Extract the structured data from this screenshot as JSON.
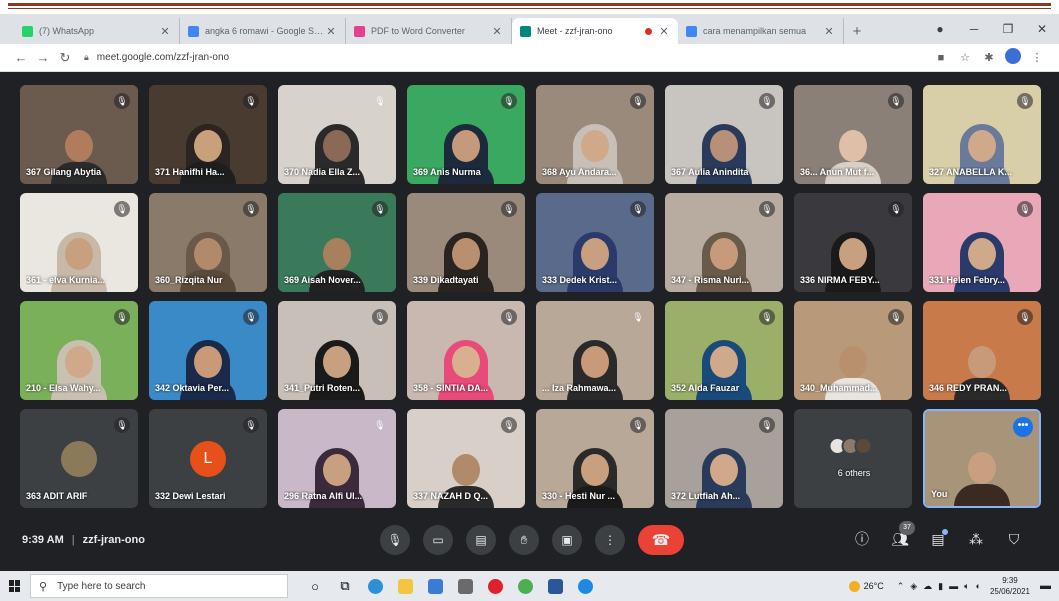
{
  "browser": {
    "tabs": [
      {
        "title": "(7) WhatsApp",
        "favicon_color": "#25d366",
        "active": false
      },
      {
        "title": "angka 6 romawi - Google Search",
        "favicon_color": "#4285f4",
        "active": false
      },
      {
        "title": "PDF to Word Converter",
        "favicon_color": "#e83e8c",
        "active": false
      },
      {
        "title": "Meet - zzf-jran-ono",
        "favicon_color": "#00897b",
        "active": true,
        "recording": true
      },
      {
        "title": "cara menampilkan semua",
        "favicon_color": "#4285f4",
        "active": false
      }
    ],
    "url": "meet.google.com/zzf-jran-ono"
  },
  "participants": [
    {
      "name": "367 Gilang Abytia",
      "bg": "#6b5a4e",
      "skin": "#b07c5c",
      "cloth": "#2b2b2b",
      "hijab": "",
      "muted": true
    },
    {
      "name": "371 Hanifhi Ha...",
      "bg": "#4a3b30",
      "skin": "#c9a07c",
      "cloth": "#1e1e1e",
      "hijab": "#2b2420",
      "muted": true
    },
    {
      "name": "370 Nadia Ella Z...",
      "bg": "#d8d2cc",
      "skin": "#8a6a56",
      "cloth": "#2a2a2a",
      "hijab": "#2a2a2a",
      "muted": false
    },
    {
      "name": "369 Anis Nurma",
      "bg": "#3aa860",
      "skin": "#c49a7a",
      "cloth": "#1c2a3c",
      "hijab": "#1c2a3c",
      "muted": true
    },
    {
      "name": "368 Ayu Andara...",
      "bg": "#9a8a7c",
      "skin": "#d0a88a",
      "cloth": "#c8c0b8",
      "hijab": "#c8c0b8",
      "muted": true
    },
    {
      "name": "367 Aulia Anindita",
      "bg": "#c8c4c0",
      "skin": "#b8907a",
      "cloth": "#2a3a5a",
      "hijab": "#2a3a5a",
      "muted": true
    },
    {
      "name": "36... Anun Mut f...",
      "bg": "#8a8078",
      "skin": "#e0bfa8",
      "cloth": "#d8cfc6",
      "hijab": "",
      "muted": true
    },
    {
      "name": "327 ANABELLA K...",
      "bg": "#d8cfa8",
      "skin": "#d0a88a",
      "cloth": "#6a7a9a",
      "hijab": "#6a7a9a",
      "muted": true
    },
    {
      "name": "361 - elva Kurnia...",
      "bg": "#eae6e0",
      "skin": "#c8a080",
      "cloth": "#c8b8a8",
      "hijab": "#c8b8a8",
      "muted": true
    },
    {
      "name": "360_Rizqita Nur",
      "bg": "#8a7a6a",
      "skin": "#b08a6a",
      "cloth": "#5a4a3a",
      "hijab": "#6a5848",
      "muted": true
    },
    {
      "name": "369 Aisah Nover...",
      "bg": "#3a7a5a",
      "skin": "#a8805e",
      "cloth": "#222",
      "hijab": "",
      "muted": true
    },
    {
      "name": "339 Dikadtayati",
      "bg": "#9a8a7c",
      "skin": "#b89070",
      "cloth": "#2a2420",
      "hijab": "#2a2420",
      "muted": true
    },
    {
      "name": "333 Dedek Krist...",
      "bg": "#5a6a8a",
      "skin": "#c8a080",
      "cloth": "#2a3a6a",
      "hijab": "#2a3a6a",
      "muted": true
    },
    {
      "name": "347 - Risma Nuri...",
      "bg": "#b8aca0",
      "skin": "#c89a7c",
      "cloth": "#6a5a4a",
      "hijab": "#6a5a4a",
      "muted": true
    },
    {
      "name": "336 NIRMA FEBY...",
      "bg": "#3a3a3e",
      "skin": "#c8a080",
      "cloth": "#1a1a1a",
      "hijab": "#1a1a1a",
      "muted": true
    },
    {
      "name": "331 Helen Febry...",
      "bg": "#e8a8b8",
      "skin": "#d0a88a",
      "cloth": "#2a3a6a",
      "hijab": "#2a3a6a",
      "muted": true
    },
    {
      "name": "210 - Elsa Wahy...",
      "bg": "#7ab05a",
      "skin": "#d0a88a",
      "cloth": "#c8c0b0",
      "hijab": "#c8c0b0",
      "muted": true
    },
    {
      "name": "342 Oktavia Per...",
      "bg": "#3a8ac8",
      "skin": "#c89a7a",
      "cloth": "#1a2a4a",
      "hijab": "#1a2a4a",
      "muted": true
    },
    {
      "name": "341_Putri Roten...",
      "bg": "#c8c0b8",
      "skin": "#c8a080",
      "cloth": "#1a1a1a",
      "hijab": "#1a1a1a",
      "muted": true
    },
    {
      "name": "358 - SINTIA DA...",
      "bg": "#c8b8b0",
      "skin": "#d8b090",
      "cloth": "#e84a7a",
      "hijab": "#e84a7a",
      "muted": true
    },
    {
      "name": "... Iza Rahmawa...",
      "bg": "#b8a898",
      "skin": "#c89a7a",
      "cloth": "#2a2a2a",
      "hijab": "#2a2a2a",
      "muted": false
    },
    {
      "name": "352 Alda Fauzar",
      "bg": "#9ab068",
      "skin": "#d0a88a",
      "cloth": "#1a4a7a",
      "hijab": "#1a4a7a",
      "muted": true
    },
    {
      "name": "340_Muhammad...",
      "bg": "#b89a7a",
      "skin": "#b8906e",
      "cloth": "#e8e4e0",
      "hijab": "",
      "muted": true
    },
    {
      "name": "346 REDY PRAN...",
      "bg": "#c87a4a",
      "skin": "#c89a7a",
      "cloth": "#2a2a2a",
      "hijab": "",
      "muted": true
    },
    {
      "name": "363 ADIT ARIF",
      "avatar": true,
      "avatar_color": "#8a7a5a",
      "avatar_letter": "",
      "muted": true
    },
    {
      "name": "332 Dewi Lestari",
      "avatar": true,
      "avatar_color": "#e8501a",
      "avatar_letter": "L",
      "muted": true
    },
    {
      "name": "296 Ratna Alfi Ul...",
      "bg": "#c8b8c8",
      "skin": "#c8a080",
      "cloth": "#3a2a3a",
      "hijab": "#3a2a3a",
      "muted": false
    },
    {
      "name": "337 NAZAH D Q...",
      "bg": "#d8d0c8",
      "skin": "#b08a6a",
      "cloth": "#2a2a2a",
      "hijab": "",
      "muted": true
    },
    {
      "name": "330 - Hesti Nur ...",
      "bg": "#b8a898",
      "skin": "#c8a080",
      "cloth": "#1a1a1a",
      "hijab": "#2a2a2a",
      "muted": true
    },
    {
      "name": "372 Lutfiah Ah...",
      "bg": "#a8a09a",
      "skin": "#d0a88a",
      "cloth": "#2a3a5a",
      "hijab": "#2a3a5a",
      "muted": true
    },
    {
      "name": "6 others",
      "others": true
    },
    {
      "name": "You",
      "you": true,
      "bg": "#a89478",
      "skin": "#c8a080",
      "cloth": "#3a2a22",
      "hijab": ""
    }
  ],
  "meeting": {
    "time": "9:39 AM",
    "separator": "|",
    "code": "zzf-jran-ono",
    "participants_count": "37"
  },
  "taskbar": {
    "search_placeholder": "Type here to search",
    "temperature": "26°C",
    "time": "9:39",
    "date": "25/06/2021"
  }
}
